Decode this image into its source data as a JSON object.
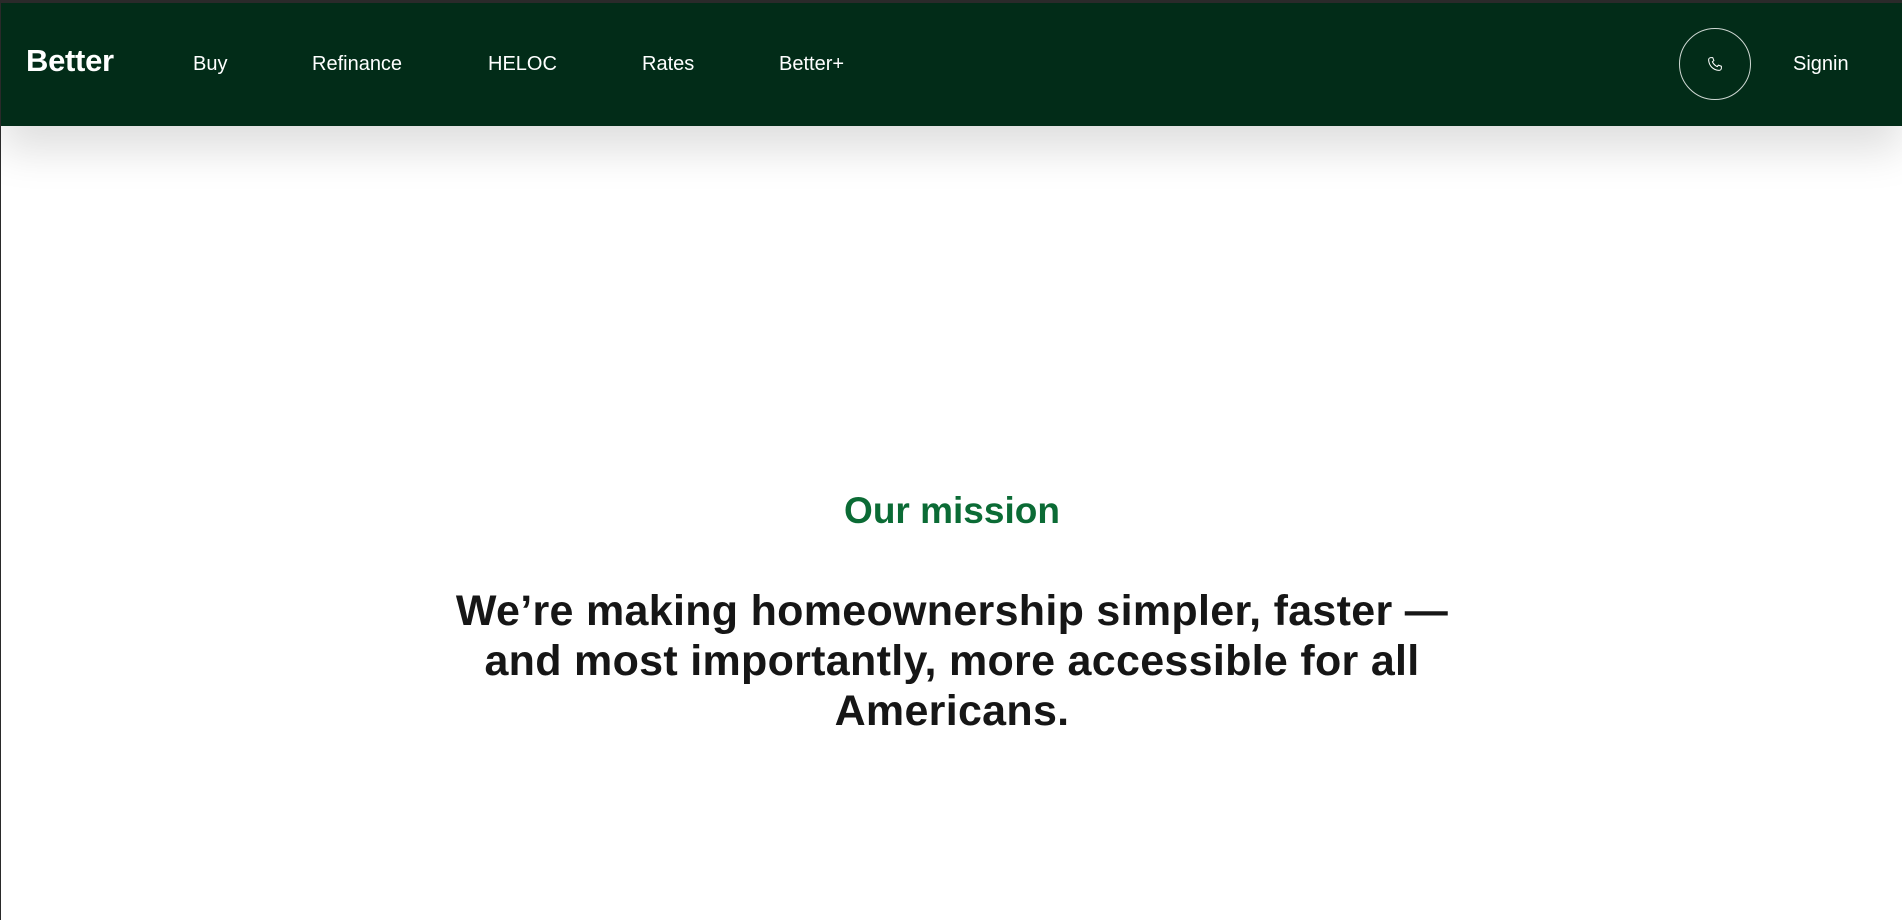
{
  "nav": {
    "logo": "Better",
    "links": [
      {
        "label": "Buy"
      },
      {
        "label": "Refinance"
      },
      {
        "label": "HELOC"
      },
      {
        "label": "Rates"
      },
      {
        "label": "Better+"
      }
    ],
    "phone_icon": "phone-icon",
    "signin_label": "Signin"
  },
  "mission": {
    "eyebrow": "Our mission",
    "statement": "We’re making homeownership simpler, faster — and most importantly, more accessible for all Americans."
  },
  "colors": {
    "nav_background": "#022c18",
    "accent_green": "#0b6b35",
    "text_dark": "#161616"
  }
}
